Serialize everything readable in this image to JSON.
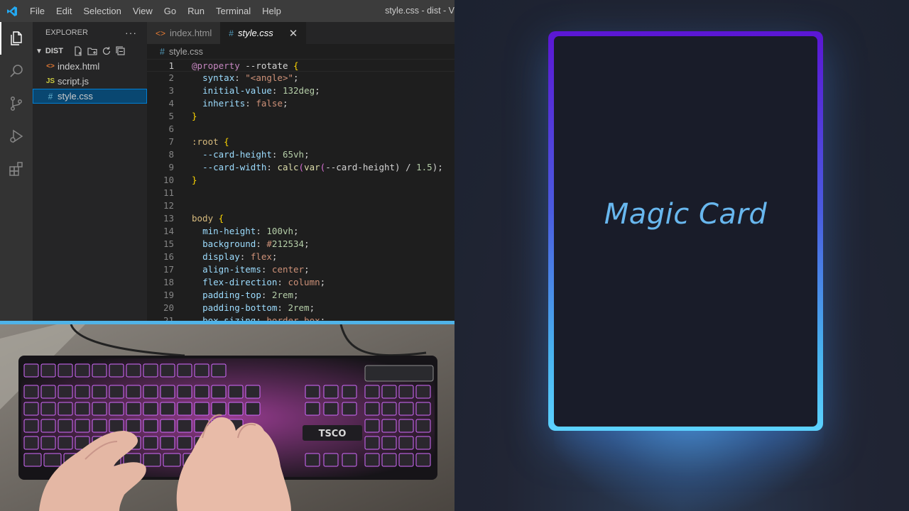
{
  "vscode": {
    "menu": [
      "File",
      "Edit",
      "Selection",
      "View",
      "Go",
      "Run",
      "Terminal",
      "Help"
    ],
    "window_title": "style.css - dist - V",
    "explorer": {
      "header": "EXPLORER",
      "more": "···",
      "folder": "DIST",
      "files": [
        {
          "name": "index.html",
          "icon": "<>",
          "selected": false
        },
        {
          "name": "script.js",
          "icon": "JS",
          "selected": false
        },
        {
          "name": "style.css",
          "icon": "#",
          "selected": true
        }
      ]
    },
    "tabs": [
      {
        "label": "index.html",
        "icon": "<>",
        "active": false
      },
      {
        "label": "style.css",
        "icon": "#",
        "active": true,
        "close": "✕"
      }
    ],
    "breadcrumb": {
      "icon": "#",
      "label": "style.css"
    },
    "code_lines": [
      {
        "n": "1",
        "text": "@property --rotate {"
      },
      {
        "n": "2",
        "text": "  syntax: \"<angle>\";"
      },
      {
        "n": "3",
        "text": "  initial-value: 132deg;"
      },
      {
        "n": "4",
        "text": "  inherits: false;"
      },
      {
        "n": "5",
        "text": "}"
      },
      {
        "n": "6",
        "text": ""
      },
      {
        "n": "7",
        "text": ":root {"
      },
      {
        "n": "8",
        "text": "  --card-height: 65vh;"
      },
      {
        "n": "9",
        "text": "  --card-width: calc(var(--card-height) / 1.5);"
      },
      {
        "n": "10",
        "text": "}"
      },
      {
        "n": "11",
        "text": ""
      },
      {
        "n": "12",
        "text": ""
      },
      {
        "n": "13",
        "text": "body {"
      },
      {
        "n": "14",
        "text": "  min-height: 100vh;"
      },
      {
        "n": "15",
        "text": "  background: #212534;"
      },
      {
        "n": "16",
        "text": "  display: flex;"
      },
      {
        "n": "17",
        "text": "  align-items: center;"
      },
      {
        "n": "18",
        "text": "  flex-direction: column;"
      },
      {
        "n": "19",
        "text": "  padding-top: 2rem;"
      },
      {
        "n": "20",
        "text": "  padding-bottom: 2rem;"
      },
      {
        "n": "21",
        "text": "  box-sizing: border-box;"
      }
    ]
  },
  "keyboard_photo": {
    "brand_label": "TSCO"
  },
  "preview": {
    "card_title": "Magic Card",
    "colors": {
      "background": "#212534",
      "border_top": "#5b16d4",
      "border_bottom": "#5cd2ff",
      "title": "#68b7ee"
    }
  }
}
